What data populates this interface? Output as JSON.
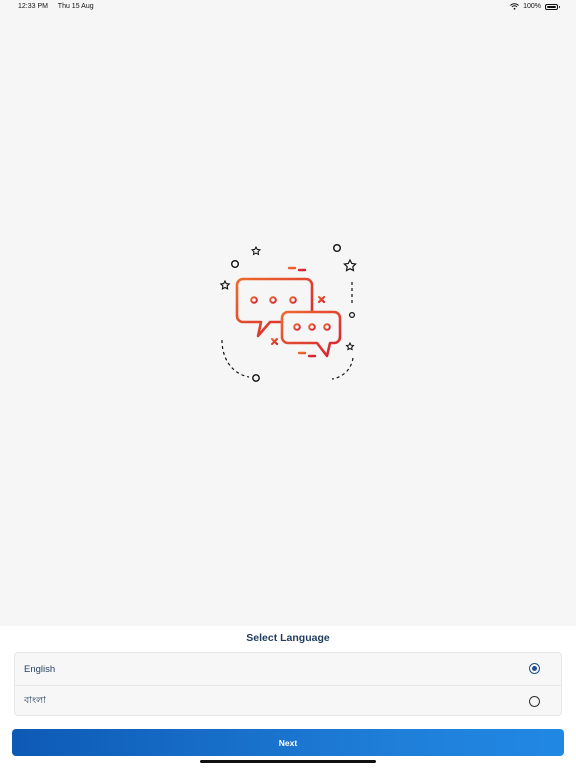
{
  "status_bar": {
    "time": "12:33 PM",
    "date": "Thu 15 Aug",
    "battery": "100%",
    "wifi_icon": "wifi-icon",
    "battery_icon": "battery-icon"
  },
  "illustration": {
    "icon": "chat-bubbles-icon",
    "colors": {
      "gradient_start": "#e8562e",
      "gradient_end": "#d8262f",
      "decor": "#111111"
    }
  },
  "language_selector": {
    "title": "Select Language",
    "options": [
      {
        "label": "English",
        "selected": true
      },
      {
        "label": "বাংলা",
        "selected": false
      }
    ]
  },
  "next_button": {
    "label": "Next"
  },
  "colors": {
    "accent": "#1f4f8c",
    "button_gradient_start": "#0d5ab5",
    "button_gradient_end": "#2088e4",
    "title": "#1f3b5e"
  }
}
